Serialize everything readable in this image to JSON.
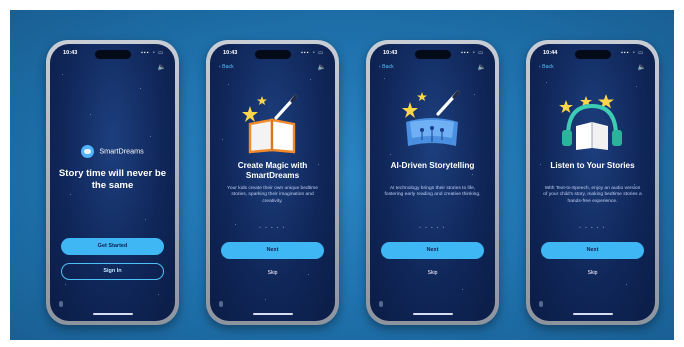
{
  "screens": [
    {
      "time": "10:43",
      "status_icons": "▪▪▪ ◔ ▭",
      "sound_icon": "speaker-icon",
      "brand": {
        "name": "SmartDreams",
        "icon": "moon-logo-icon"
      },
      "headline": "Story time will never be the same",
      "primary_button": "Get Started",
      "secondary_button": "Sign In"
    },
    {
      "time": "10:43",
      "status_icons": "▪▪▪ ◔ ▭",
      "back_label": "‹ Back",
      "sound_icon": "speaker-icon",
      "illustration": "open-book-magic-wand-icon",
      "title": "Create Magic with SmartDreams",
      "body": "Your kids create their own unique bedtime stories, sparking their imagination and creativity.",
      "dots": "• • • • •",
      "next_button": "Next",
      "skip_label": "Skip"
    },
    {
      "time": "10:43",
      "status_icons": "▪▪▪ ◔ ▭",
      "back_label": "‹ Back",
      "sound_icon": "speaker-icon",
      "illustration": "ai-brain-book-icon",
      "title": "AI-Driven Storytelling",
      "body": "AI technology brings their stories to life, fostering early reading and creative thinking.",
      "dots": "• • • • •",
      "next_button": "Next",
      "skip_label": "Skip"
    },
    {
      "time": "10:44",
      "status_icons": "▪▪▪ ◔ ▭",
      "back_label": "‹ Back",
      "sound_icon": "speaker-icon",
      "illustration": "headphones-book-icon",
      "title": "Listen to Your Stories",
      "body": "With Text-to-Speech, enjoy an audio version of your child's story, making bedtime stories a hands-free experience.",
      "dots": "• • • • •",
      "next_button": "Next",
      "skip_label": "Skip"
    }
  ],
  "colors": {
    "background": "#1e6fa9",
    "screen_bg": "#10275a",
    "accent": "#3fb7f5",
    "star": "#ffd54a",
    "book_cover": "#f08a2c"
  }
}
